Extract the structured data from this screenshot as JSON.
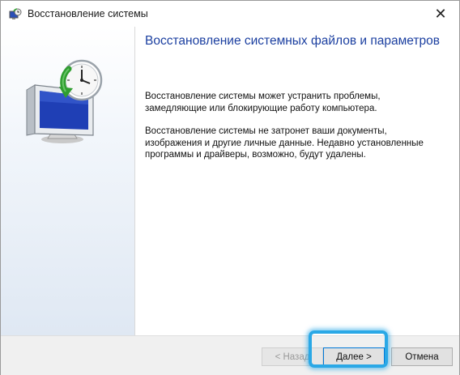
{
  "window": {
    "title": "Восстановление системы",
    "close_glyph": "✕"
  },
  "content": {
    "heading": "Восстановление системных файлов и параметров",
    "paragraph1": "Восстановление системы может устранить проблемы, замедляющие или блокирующие работу компьютера.",
    "paragraph2": "Восстановление системы не затронет ваши документы, изображения и другие личные данные. Недавно установленные программы и драйверы, возможно, будут удалены."
  },
  "footer": {
    "back_label": "< Назад",
    "next_label": "Далее >",
    "cancel_label": "Отмена"
  },
  "icons": {
    "title": "system-restore-icon",
    "hero": "system-restore-monitor-clock-icon"
  },
  "colors": {
    "heading": "#1b3fa0",
    "highlight": "#2aa8e6"
  }
}
